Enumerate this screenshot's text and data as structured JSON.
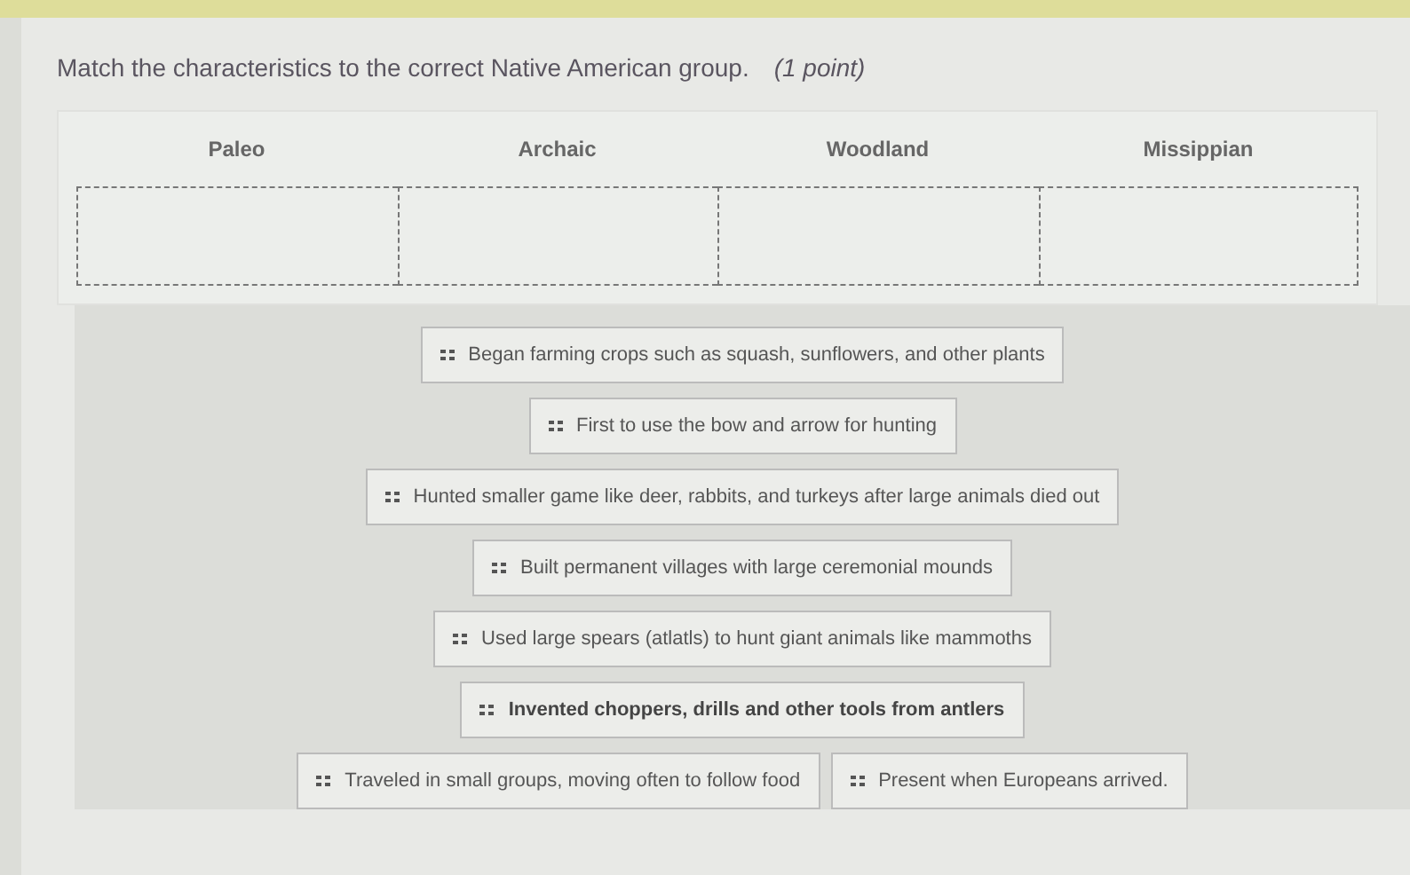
{
  "question": {
    "prompt": "Match the characteristics to the correct Native American group.",
    "points": "(1 point)"
  },
  "groups": [
    {
      "label": "Paleo"
    },
    {
      "label": "Archaic"
    },
    {
      "label": "Woodland"
    },
    {
      "label": "Missippian"
    }
  ],
  "card_rows": [
    [
      {
        "text": "Began farming crops such as squash, sunflowers, and other plants",
        "highlighted": false
      }
    ],
    [
      {
        "text": "First to use the bow and arrow for hunting",
        "highlighted": false
      }
    ],
    [
      {
        "text": "Hunted smaller game like deer, rabbits, and turkeys after large animals died out",
        "highlighted": false
      }
    ],
    [
      {
        "text": "Built permanent villages with large ceremonial mounds",
        "highlighted": false
      }
    ],
    [
      {
        "text": "Used large spears (atlatls) to hunt giant animals like mammoths",
        "highlighted": false
      }
    ],
    [
      {
        "text": "Invented choppers, drills and other tools from antlers",
        "highlighted": true
      }
    ],
    [
      {
        "text": "Traveled in small groups, moving often to follow food",
        "highlighted": false
      },
      {
        "text": "Present when Europeans arrived.",
        "highlighted": false
      }
    ]
  ]
}
